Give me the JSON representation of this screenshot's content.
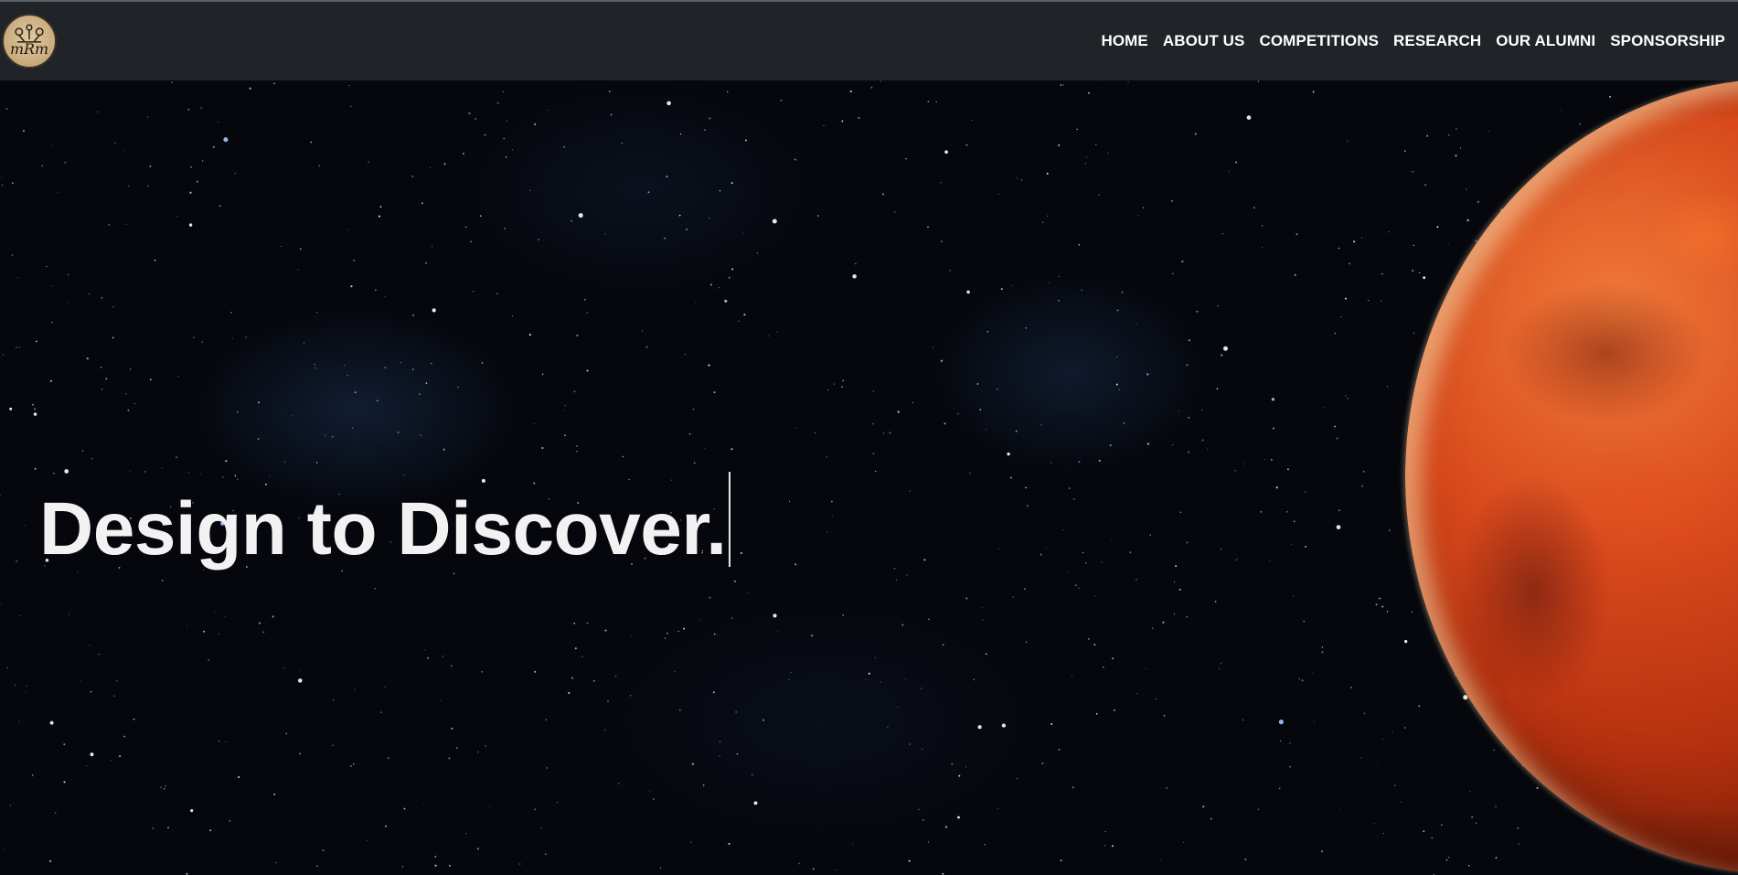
{
  "navbar": {
    "logo": {
      "text": "mRm",
      "icon": "rover-logo-icon"
    },
    "links": [
      {
        "label": "HOME"
      },
      {
        "label": "ABOUT US"
      },
      {
        "label": "COMPETITIONS"
      },
      {
        "label": "RESEARCH"
      },
      {
        "label": "OUR ALUMNI"
      },
      {
        "label": "SPONSORSHIP"
      }
    ]
  },
  "hero": {
    "headline": "Design to Discover.",
    "background": "starfield-with-mars",
    "colors": {
      "navbar": "#202327",
      "space": "#05070c",
      "planet": "#d9491c",
      "headline": "#f2f2f2"
    }
  }
}
